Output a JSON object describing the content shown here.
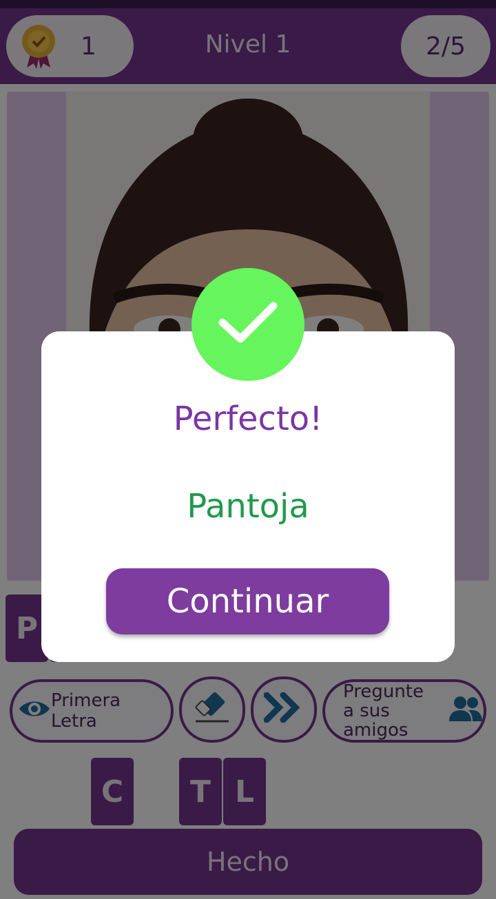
{
  "header": {
    "score": "1",
    "level_title": "Nivel 1",
    "progress": "2/5"
  },
  "answer_tiles": [
    "P"
  ],
  "tools": {
    "first_letter_label": "Primera Letra",
    "ask_friends_label": "Pregunte a sus amigos"
  },
  "letter_tiles": [
    "C",
    "T",
    "L"
  ],
  "done_button": "Hecho",
  "dialog": {
    "title": "Perfecto!",
    "answer": "Pantoja",
    "continue_label": "Continuar"
  },
  "colors": {
    "primary": "#74358f",
    "success": "#66f55c",
    "answer_text": "#1f9a4a"
  },
  "icons": [
    "medal-icon",
    "eye-icon",
    "eraser-icon",
    "skip-icon",
    "friends-icon",
    "checkmark-icon"
  ]
}
